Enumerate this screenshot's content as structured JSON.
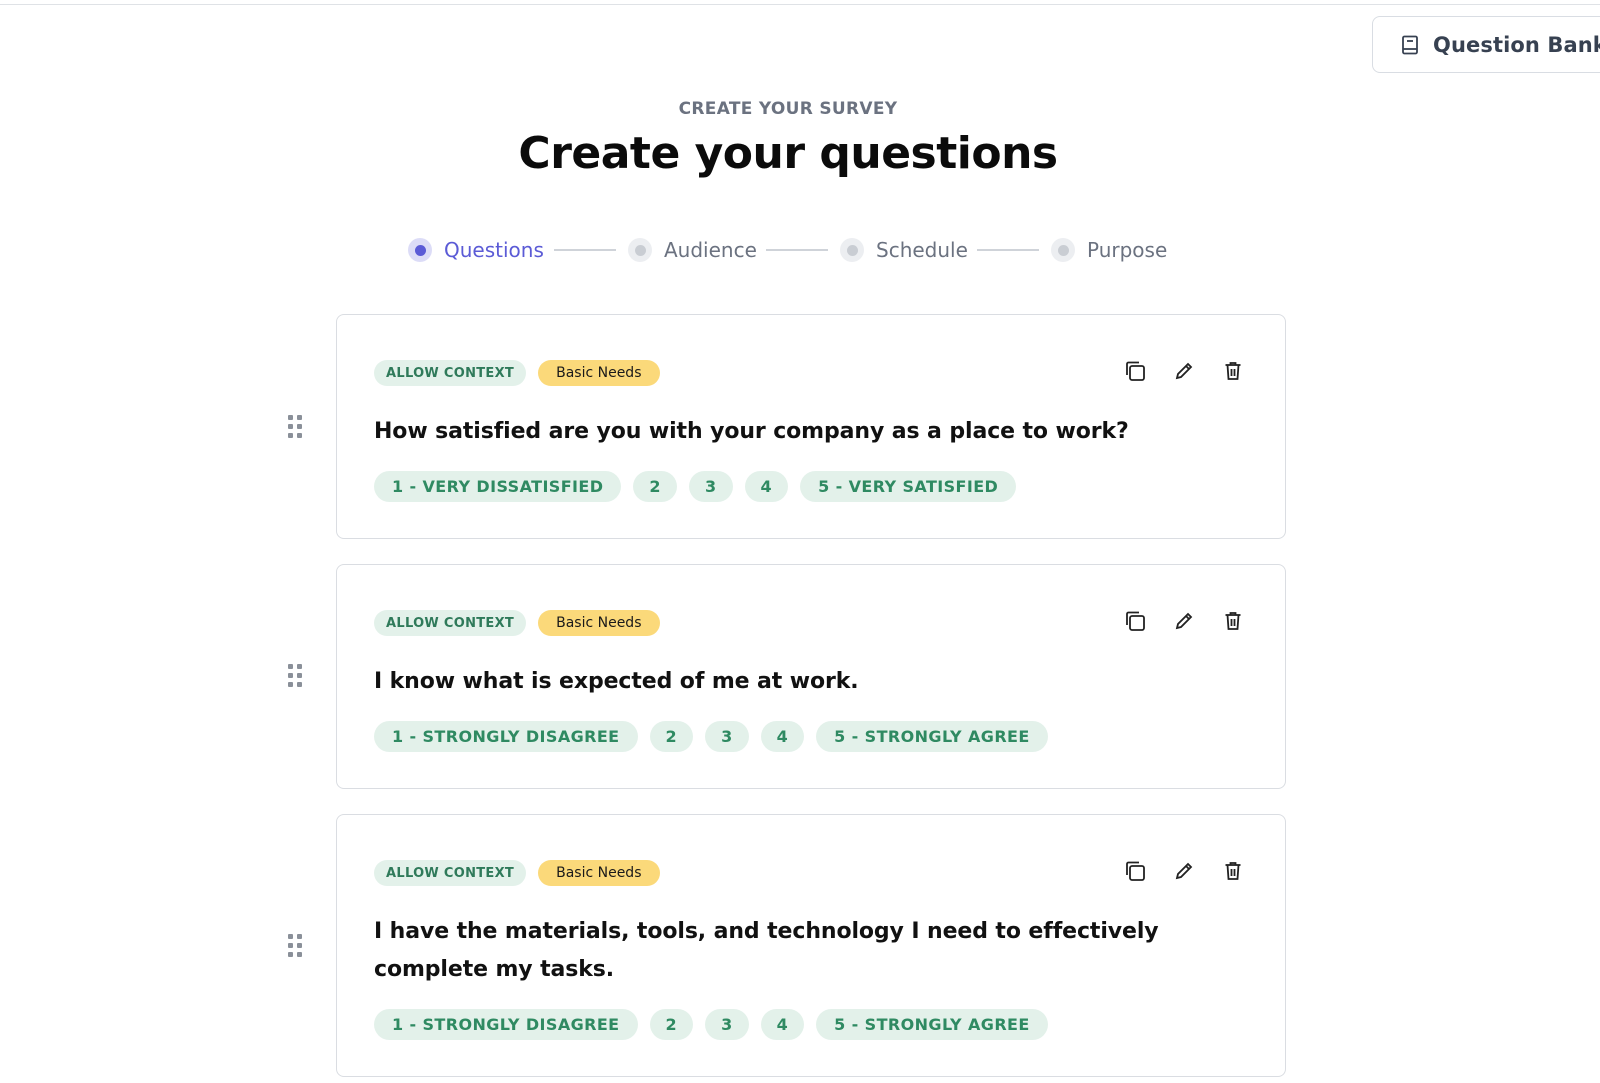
{
  "header": {
    "question_bank_label": "Question Bank",
    "eyebrow": "CREATE YOUR SURVEY",
    "title": "Create your questions"
  },
  "stepper": {
    "steps": [
      {
        "label": "Questions",
        "active": true
      },
      {
        "label": "Audience",
        "active": false
      },
      {
        "label": "Schedule",
        "active": false
      },
      {
        "label": "Purpose",
        "active": false
      }
    ]
  },
  "questions": [
    {
      "context_tag": "ALLOW CONTEXT",
      "category_tag": "Basic Needs",
      "text": "How satisfied are you with your company as a place to work?",
      "scale": [
        "1 - VERY DISSATISFIED",
        "2",
        "3",
        "4",
        "5 - VERY SATISFIED"
      ]
    },
    {
      "context_tag": "ALLOW CONTEXT",
      "category_tag": "Basic Needs",
      "text": "I know what is expected of me at work.",
      "scale": [
        "1 - STRONGLY DISAGREE",
        "2",
        "3",
        "4",
        "5 - STRONGLY AGREE"
      ]
    },
    {
      "context_tag": "ALLOW CONTEXT",
      "category_tag": "Basic Needs",
      "text": "I have the materials, tools, and technology I need to effectively complete my tasks.",
      "scale": [
        "1 - STRONGLY DISAGREE",
        "2",
        "3",
        "4",
        "5 - STRONGLY AGREE"
      ]
    }
  ],
  "icons": {
    "question_bank": "book-icon",
    "duplicate": "copy-icon",
    "edit": "pencil-icon",
    "delete": "trash-icon",
    "drag": "drag-handle-icon"
  },
  "colors": {
    "accent": "#5b5bd6",
    "context_tag_bg": "#e3f1ea",
    "context_tag_text": "#2f7a5a",
    "category_tag_bg": "#fbd97a",
    "chip_text": "#2f8a62"
  }
}
